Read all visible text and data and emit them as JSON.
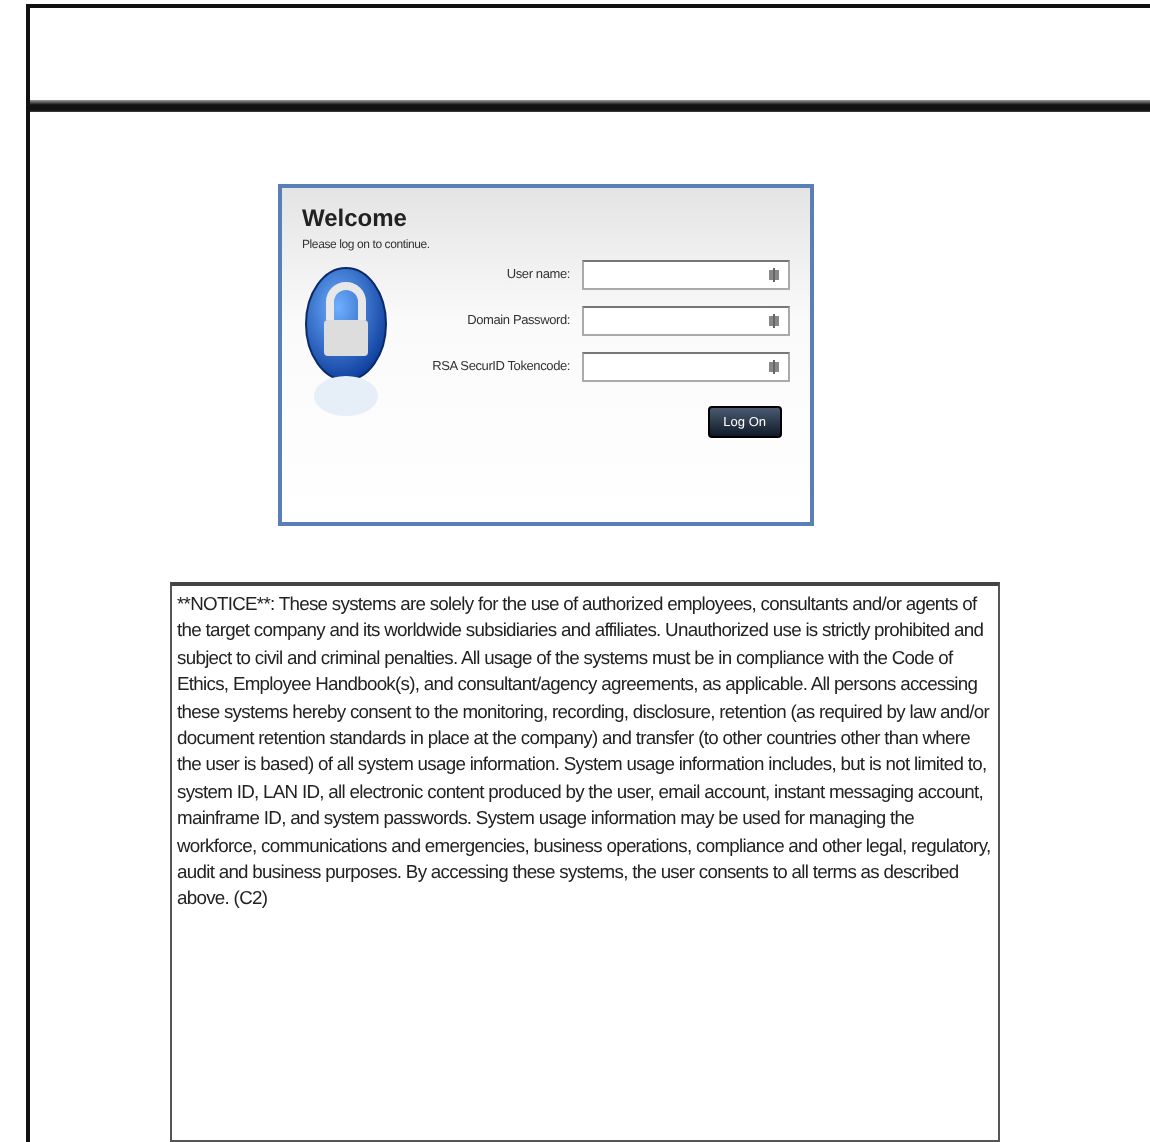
{
  "login": {
    "title": "Welcome",
    "subtitle": "Please log on to continue.",
    "fields": [
      {
        "label": "User name:"
      },
      {
        "label": "Domain Password:"
      },
      {
        "label": "RSA SecurID Tokencode:"
      }
    ],
    "button": "Log On"
  },
  "notice": "**NOTICE**: These systems are solely for the use of authorized employees, consultants and/or agents of the target company and its worldwide subsidiaries and affiliates. Unauthorized use is strictly prohibited and subject to civil and criminal penalties. All usage of the systems must be in compliance with the Code of Ethics, Employee Handbook(s), and consultant/agency agreements, as applicable. All persons accessing these systems hereby consent to the monitoring, recording, disclosure, retention (as required by law and/or document retention standards in place at the company) and transfer (to other countries other than where the user is based) of all system usage information. System usage information includes, but is not limited to, system ID, LAN ID, all electronic content produced by the user, email account, instant messaging account, mainframe ID, and system passwords. System usage information may be used for managing the workforce, communications and emergencies, business operations, compliance and other legal, regulatory, audit and business purposes. By accessing these systems, the user consents to all terms as described above. (C2)"
}
